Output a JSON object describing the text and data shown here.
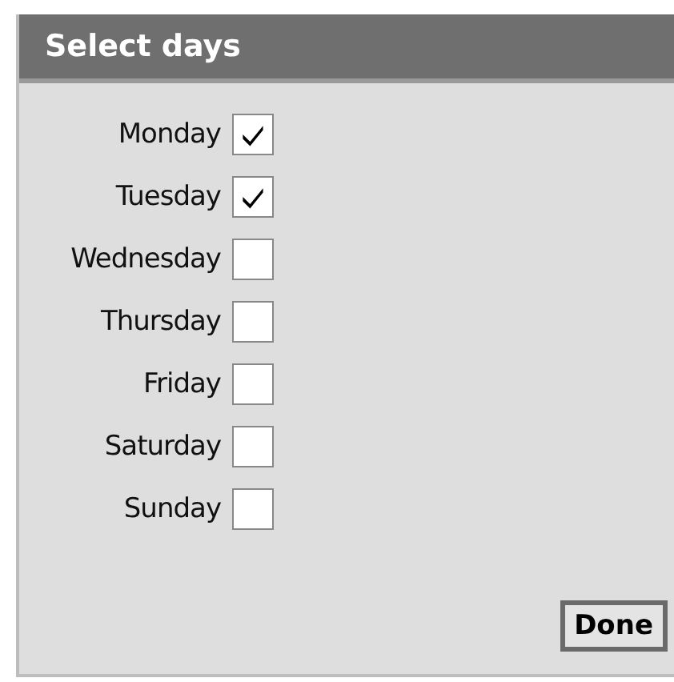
{
  "window": {
    "title": "Select days"
  },
  "days": [
    {
      "label": "Monday",
      "checked": true
    },
    {
      "label": "Tuesday",
      "checked": true
    },
    {
      "label": "Wednesday",
      "checked": false
    },
    {
      "label": "Thursday",
      "checked": false
    },
    {
      "label": "Friday",
      "checked": false
    },
    {
      "label": "Saturday",
      "checked": false
    },
    {
      "label": "Sunday",
      "checked": false
    }
  ],
  "buttons": [
    {
      "label": "Done"
    }
  ]
}
